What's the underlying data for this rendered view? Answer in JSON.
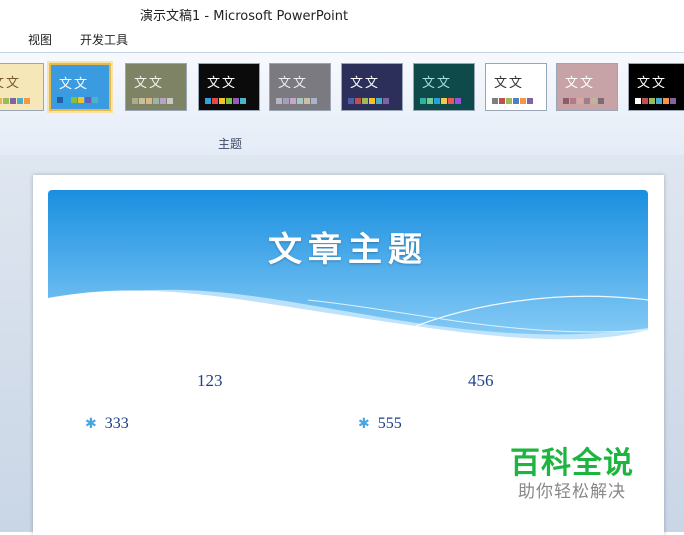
{
  "window": {
    "title": "演示文稿1  -  Microsoft PowerPoint"
  },
  "menu": {
    "items": [
      {
        "label": "视图"
      },
      {
        "label": "开发工具"
      }
    ]
  },
  "ribbon": {
    "group_label": "主题",
    "themes": [
      {
        "text": "文文",
        "bg": "#f6e7b8",
        "fg": "#7a5a2a",
        "swatches": [
          "#c0504d",
          "#e9b45a",
          "#9bbb59",
          "#8064a2",
          "#4bacc6",
          "#f79646"
        ]
      },
      {
        "text": "文文",
        "bg": "#3a9be0",
        "fg": "#ffffff",
        "swatches": [
          "#1f5fa8",
          "#2fa3e0",
          "#7fc242",
          "#f3c12b",
          "#6a5bb5",
          "#49b5c8"
        ],
        "selected": true
      },
      {
        "text": "文文",
        "bg": "#7e8366",
        "fg": "#f2f2e6",
        "swatches": [
          "#a9ae8d",
          "#c7c19a",
          "#d6b88a",
          "#9fb3a0",
          "#b9a3c2",
          "#c9c9c9"
        ]
      },
      {
        "text": "文文",
        "bg": "#0b0b0b",
        "fg": "#ffffff",
        "swatches": [
          "#2fa3e0",
          "#e9483f",
          "#f3c12b",
          "#7fc242",
          "#9b59b6",
          "#49b5c8"
        ]
      },
      {
        "text": "文文",
        "bg": "#7a7a80",
        "fg": "#eeeeee",
        "swatches": [
          "#b7b7c2",
          "#9fa0b9",
          "#c6a7c8",
          "#a7c8c0",
          "#c8c1a7",
          "#a7b4c8"
        ]
      },
      {
        "text": "文文",
        "bg": "#2c2f5a",
        "fg": "#ffffff",
        "swatches": [
          "#4f5cab",
          "#c0504d",
          "#9bbb59",
          "#f3c12b",
          "#4bacc6",
          "#8064a2"
        ]
      },
      {
        "text": "文文",
        "bg": "#0e4a4a",
        "fg": "#9fe0e0",
        "swatches": [
          "#2fb39e",
          "#6fcf97",
          "#2d9cdb",
          "#f2c94c",
          "#eb5757",
          "#9b51e0"
        ]
      },
      {
        "text": "文文",
        "bg": "#ffffff",
        "fg": "#333333",
        "swatches": [
          "#7f7f7f",
          "#c0504d",
          "#9bbb59",
          "#4f81bd",
          "#f79646",
          "#8064a2"
        ]
      },
      {
        "text": "文文",
        "bg": "#c7a3a8",
        "fg": "#ffffff",
        "swatches": [
          "#8e5b66",
          "#b67a84",
          "#d9a7a0",
          "#9d7f8a",
          "#c4b39b",
          "#7f6a7a"
        ]
      },
      {
        "text": "文文",
        "bg": "#000000",
        "fg": "#ffffff",
        "swatches": [
          "#ffffff",
          "#c0504d",
          "#9bbb59",
          "#4bacc6",
          "#f79646",
          "#8064a2"
        ]
      }
    ]
  },
  "slide": {
    "title": "文章主题",
    "left_heading": "123",
    "right_heading": "456",
    "left_bullet": "333",
    "right_bullet": "555"
  },
  "watermark": {
    "main": "百科全说",
    "sub": "助你轻松解决"
  }
}
